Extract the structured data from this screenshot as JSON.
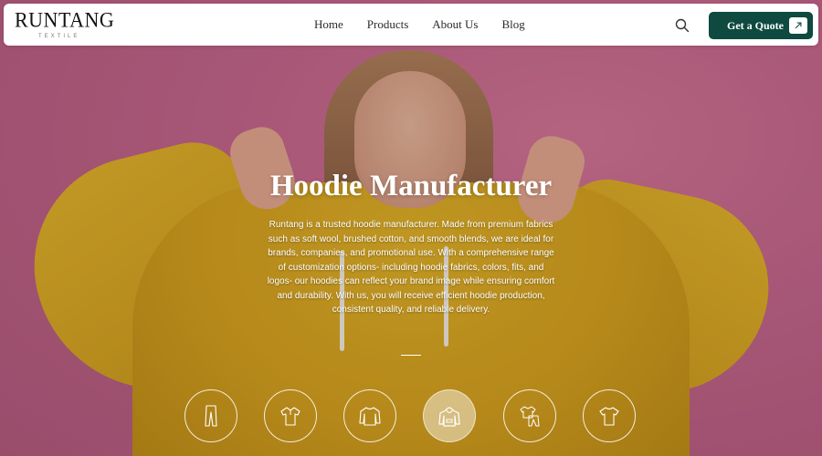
{
  "brand": {
    "name": "RUNTANG",
    "tagline": "TEXTILE"
  },
  "nav": {
    "links": [
      "Home",
      "Products",
      "About Us",
      "Blog"
    ],
    "search_icon": "search-icon",
    "cta_label": "Get a Quote",
    "cta_icon": "arrow-up-right-icon"
  },
  "hero": {
    "title": "Hoodie Manufacturer",
    "description": "Runtang is a trusted hoodie manufacturer. Made from premium fabrics such as soft wool, brushed cotton, and smooth blends, we are ideal for brands, companies, and promotional use. With a comprehensive range of customization options- including hoodie fabrics, colors, fits, and logos- our hoodies can reflect your brand image while ensuring comfort and durability. With us, you will receive efficient hoodie production, consistent quality, and reliable delivery."
  },
  "categories": [
    {
      "icon": "leggings-icon",
      "active": false
    },
    {
      "icon": "polo-shirt-icon",
      "active": false
    },
    {
      "icon": "sweatshirt-icon",
      "active": false
    },
    {
      "icon": "hoodie-icon",
      "active": true
    },
    {
      "icon": "tracksuit-icon",
      "active": false
    },
    {
      "icon": "t-shirt-icon",
      "active": false
    }
  ],
  "colors": {
    "nav_bg": "#ffffff",
    "cta_bg": "#0e4a3f",
    "hero_bg": "#c35f83",
    "hoodie": "#d6a21a",
    "text_light": "#ffffff"
  }
}
